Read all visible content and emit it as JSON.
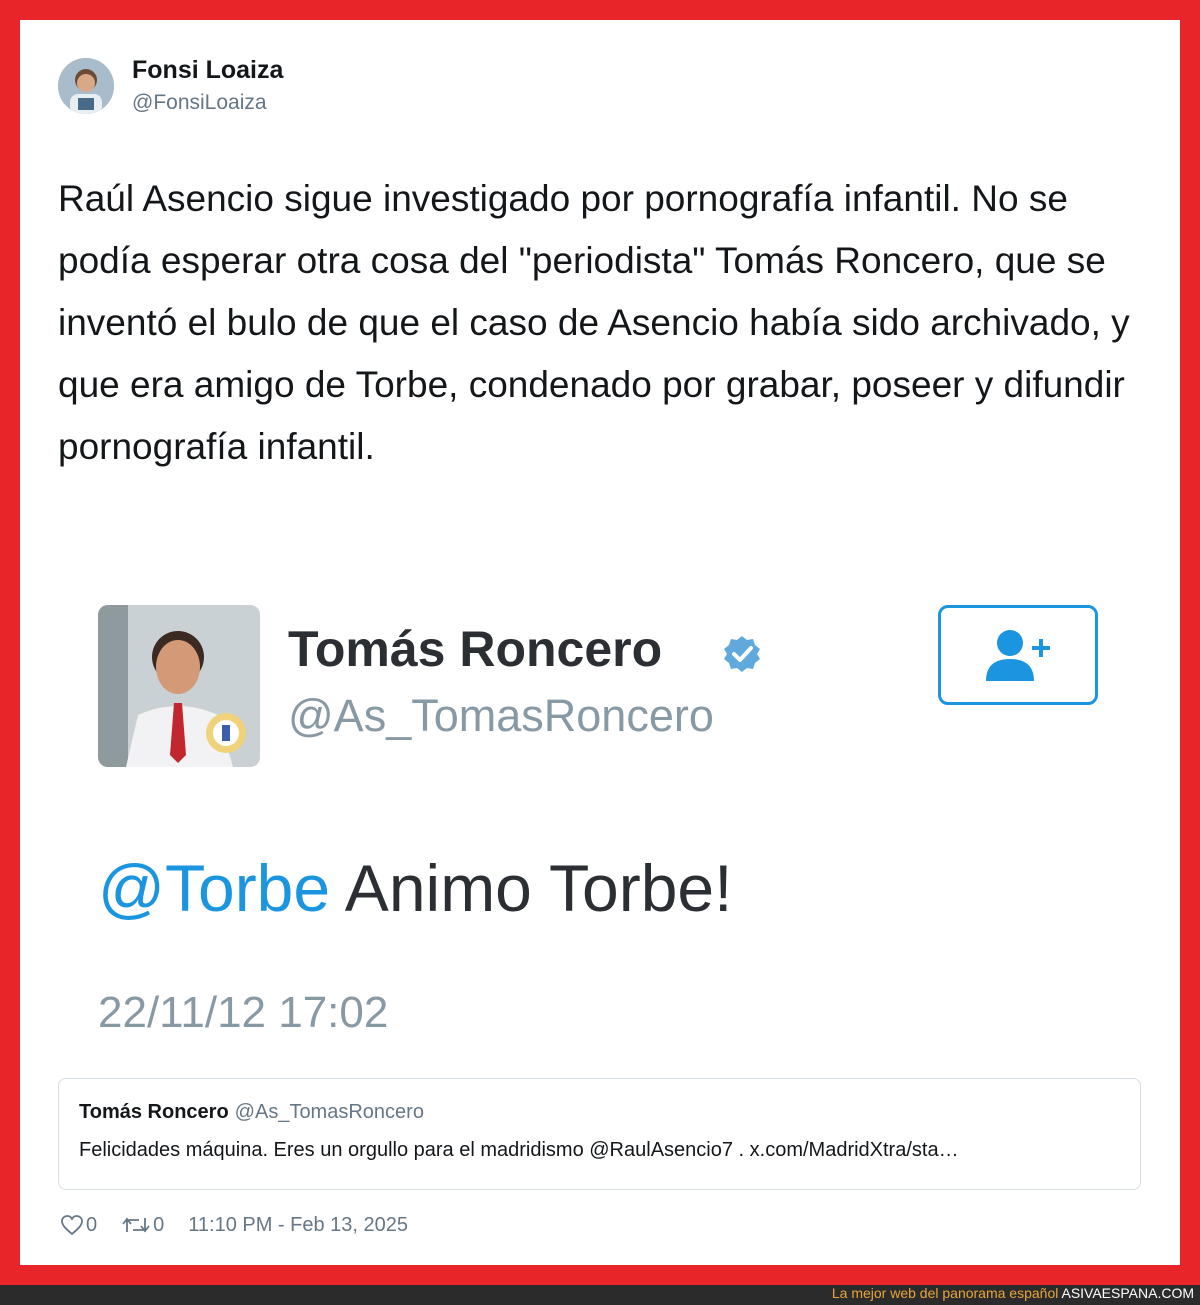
{
  "author": {
    "name": "Fonsi Loaiza",
    "handle": "@FonsiLoaiza"
  },
  "tweet": {
    "text": "Raúl Asencio sigue investigado por pornografía infantil. No se podía esperar otra cosa del \"periodista\" Tomás Roncero, que se inventó el bulo de que el caso de Asencio había sido archivado, y que era amigo de Torbe, condenado por grabar, poseer y difundir pornografía infantil."
  },
  "embedded_image": {
    "name": "Tomás Roncero",
    "handle": "@As_TomasRoncero",
    "mention": "@Torbe",
    "text": " Animo Torbe!",
    "timestamp": "22/11/12 17:02"
  },
  "quote": {
    "name": "Tomás Roncero",
    "handle": "@As_TomasRoncero",
    "text": "Felicidades máquina. Eres un orgullo para el madridismo @RaulAsencio7 . x.com/MadridXtra/sta…"
  },
  "footer": {
    "likes": "0",
    "retweets": "0",
    "timestamp": "11:10 PM - Feb 13, 2025"
  },
  "site_banner": {
    "tagline": "La mejor web del panorama español",
    "site": "ASIVAESPANA.COM"
  },
  "colors": {
    "frame": "#e8262a",
    "accent": "#1b95e0",
    "text": "#14171a",
    "muted": "#657786"
  }
}
